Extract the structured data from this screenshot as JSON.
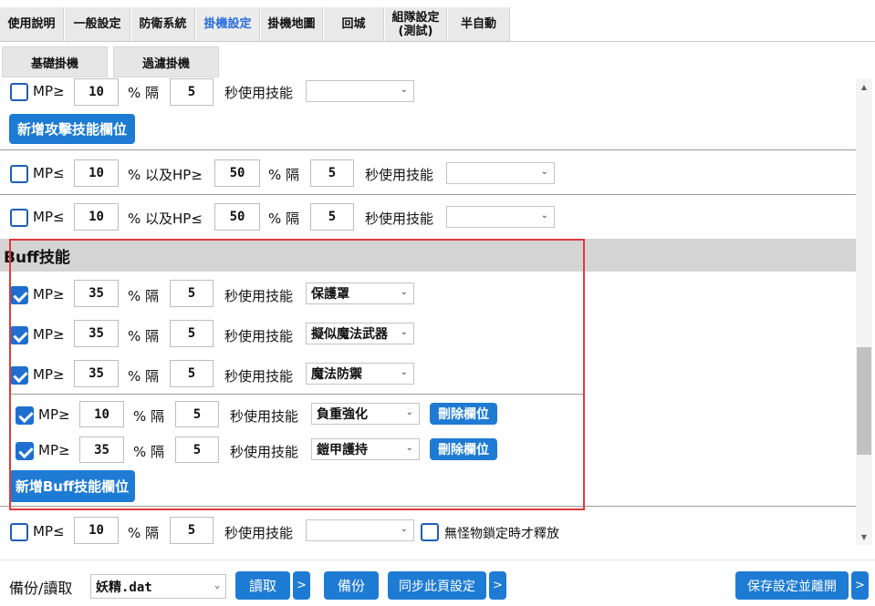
{
  "tabs": [
    {
      "label": "使用說明"
    },
    {
      "label": "一般設定"
    },
    {
      "label": "防衛系統"
    },
    {
      "label": "掛機設定",
      "active": true
    },
    {
      "label": "掛機地圖"
    },
    {
      "label": "回城"
    },
    {
      "label": "組隊設定\n(測試)"
    },
    {
      "label": "半自動"
    }
  ],
  "subtabs": [
    "基礎掛機",
    "過濾掛機"
  ],
  "labels": {
    "mp_ge": "MP≥",
    "mp_le": "MP≤",
    "pct_interval": "% 隔",
    "pct_and_hp_ge": "% 以及HP≥",
    "pct_and_hp_le": "% 以及HP≤",
    "pct": "%",
    "interval": "隔",
    "sec_use_skill": "秒使用技能",
    "lock_only": "無怪物鎖定時才釋放"
  },
  "attack": {
    "row1": {
      "checked": false,
      "mp": "10",
      "interval": "5",
      "skill": ""
    },
    "add_button": "新增攻擊技能欄位"
  },
  "hp_rows": [
    {
      "checked": false,
      "mp": "10",
      "hp": "50",
      "interval": "5",
      "skill": ""
    },
    {
      "checked": false,
      "mp": "10",
      "hp": "50",
      "interval": "5",
      "skill": ""
    }
  ],
  "buff": {
    "heading": "Buff技能",
    "rows": [
      {
        "checked": true,
        "mp": "35",
        "interval": "5",
        "skill": "保護罩"
      },
      {
        "checked": true,
        "mp": "35",
        "interval": "5",
        "skill": "擬似魔法武器"
      },
      {
        "checked": true,
        "mp": "35",
        "interval": "5",
        "skill": "魔法防禦"
      }
    ],
    "extra_rows": [
      {
        "checked": true,
        "mp": "10",
        "interval": "5",
        "skill": "負重強化",
        "delete": "刪除欄位"
      },
      {
        "checked": true,
        "mp": "35",
        "interval": "5",
        "skill": "鎧甲護持",
        "delete": "刪除欄位"
      }
    ],
    "add_button": "新增Buff技能欄位"
  },
  "bottom_row": {
    "checked": false,
    "mp": "10",
    "interval": "5",
    "skill": "",
    "lock_checked": false
  },
  "footer": {
    "backup_label": "備份/讀取",
    "file": "妖精.dat",
    "read": "讀取",
    "more": ">",
    "backup": "備份",
    "sync": "同步此頁設定",
    "save_exit": "保存設定並離開"
  },
  "colors": {
    "accent": "#1e7bd4",
    "checkbox": "#1f6fd0",
    "highlight_box": "#e03a3a",
    "section_bg": "#d4d4d4"
  }
}
